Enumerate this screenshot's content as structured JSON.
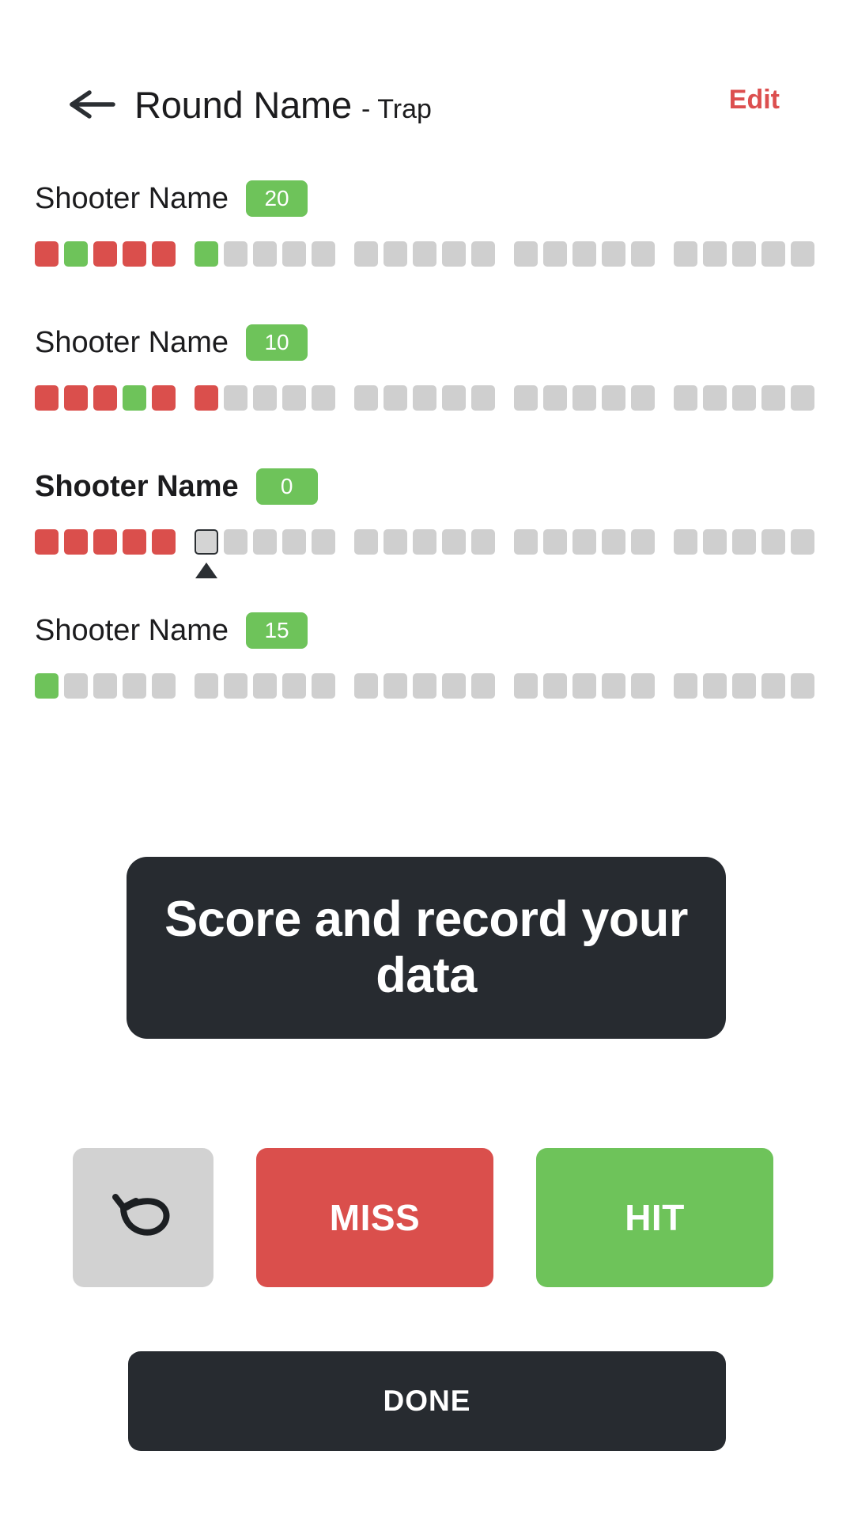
{
  "header": {
    "back_icon": "arrow-left-icon",
    "title_main": "Round Name",
    "title_dash": "-",
    "title_sub": "Trap",
    "edit_label": "Edit",
    "edit_color": "#dc4f4f"
  },
  "colors": {
    "hit": "#6ec35a",
    "miss": "#da4f4c",
    "empty": "#cfcfcf",
    "current_border": "#2b2f33",
    "dark": "#272b30"
  },
  "shooters": [
    {
      "name": "Shooter Name",
      "score": "20",
      "active": false,
      "groups": [
        [
          "miss",
          "hit",
          "miss",
          "miss",
          "miss"
        ],
        [
          "hit",
          "empty",
          "empty",
          "empty",
          "empty"
        ],
        [
          "empty",
          "empty",
          "empty",
          "empty",
          "empty"
        ],
        [
          "empty",
          "empty",
          "empty",
          "empty",
          "empty"
        ],
        [
          "empty",
          "empty",
          "empty",
          "empty",
          "empty"
        ]
      ]
    },
    {
      "name": "Shooter Name",
      "score": "10",
      "active": false,
      "groups": [
        [
          "miss",
          "miss",
          "miss",
          "hit",
          "miss"
        ],
        [
          "miss",
          "empty",
          "empty",
          "empty",
          "empty"
        ],
        [
          "empty",
          "empty",
          "empty",
          "empty",
          "empty"
        ],
        [
          "empty",
          "empty",
          "empty",
          "empty",
          "empty"
        ],
        [
          "empty",
          "empty",
          "empty",
          "empty",
          "empty"
        ]
      ]
    },
    {
      "name": "Shooter Name",
      "score": "0",
      "active": true,
      "marker_group": 1,
      "marker_index": 0,
      "groups": [
        [
          "miss",
          "miss",
          "miss",
          "miss",
          "miss"
        ],
        [
          "current",
          "empty",
          "empty",
          "empty",
          "empty"
        ],
        [
          "empty",
          "empty",
          "empty",
          "empty",
          "empty"
        ],
        [
          "empty",
          "empty",
          "empty",
          "empty",
          "empty"
        ],
        [
          "empty",
          "empty",
          "empty",
          "empty",
          "empty"
        ]
      ]
    },
    {
      "name": "Shooter Name",
      "score": "15",
      "active": false,
      "groups": [
        [
          "hit",
          "empty",
          "empty",
          "empty",
          "empty"
        ],
        [
          "empty",
          "empty",
          "empty",
          "empty",
          "empty"
        ],
        [
          "empty",
          "empty",
          "empty",
          "empty",
          "empty"
        ],
        [
          "empty",
          "empty",
          "empty",
          "empty",
          "empty"
        ],
        [
          "empty",
          "empty",
          "empty",
          "empty",
          "empty"
        ]
      ]
    }
  ],
  "callout": {
    "text": "Score and record your data"
  },
  "actions": {
    "undo_icon": "undo-arrow-icon",
    "miss_label": "MISS",
    "hit_label": "HIT"
  },
  "done": {
    "label": "DONE"
  }
}
